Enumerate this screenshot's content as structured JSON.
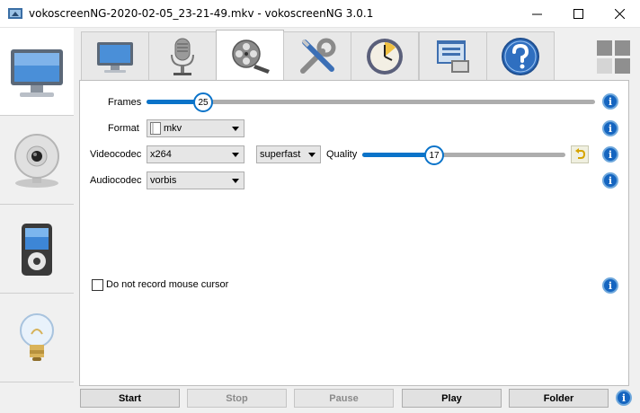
{
  "window": {
    "title": "vokoscreenNG-2020-02-05_23-21-49.mkv - vokoscreenNG 3.0.1"
  },
  "sidebar": {
    "tabs": [
      {
        "icon": "monitor-icon",
        "active": true
      },
      {
        "icon": "webcam-icon",
        "active": false
      },
      {
        "icon": "media-player-icon",
        "active": false
      },
      {
        "icon": "lightbulb-icon",
        "active": false
      }
    ]
  },
  "top_tabs": [
    {
      "icon": "monitor-icon",
      "active": false
    },
    {
      "icon": "microphone-icon",
      "active": false
    },
    {
      "icon": "film-reel-icon",
      "active": true
    },
    {
      "icon": "tools-icon",
      "active": false
    },
    {
      "icon": "clock-icon",
      "active": false
    },
    {
      "icon": "window-icon",
      "active": false
    },
    {
      "icon": "help-icon",
      "active": false
    }
  ],
  "form": {
    "frames": {
      "label": "Frames",
      "value": "25",
      "level": 0.11
    },
    "format": {
      "label": "Format",
      "value": "mkv"
    },
    "videocodec": {
      "label": "Videocodec",
      "value": "x264",
      "preset": "superfast",
      "quality_label": "Quality",
      "quality_value": "17",
      "quality_level": 0.34
    },
    "audiocodec": {
      "label": "Audiocodec",
      "value": "vorbis"
    },
    "mouse_cursor": {
      "label": "Do not record mouse cursor",
      "checked": false
    }
  },
  "buttons": {
    "start": "Start",
    "stop": "Stop",
    "pause": "Pause",
    "play": "Play",
    "folder": "Folder"
  },
  "info_glyph": "i",
  "colors": {
    "accent": "#0a73c9",
    "info": "#1565c0"
  }
}
